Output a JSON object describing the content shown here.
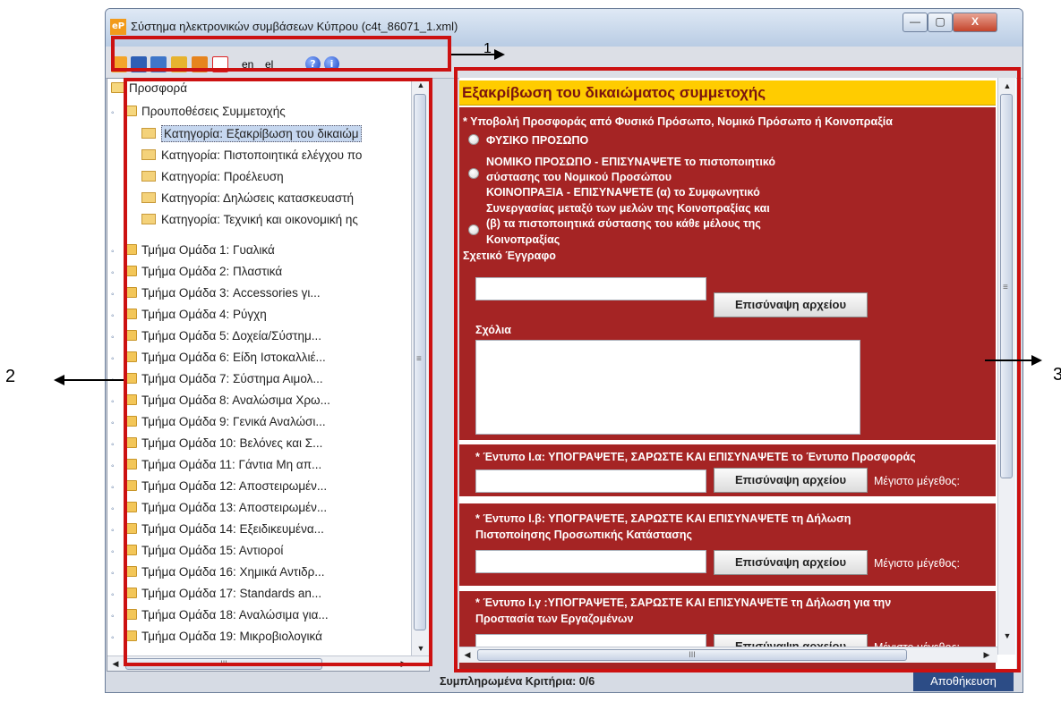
{
  "window": {
    "title": "Σύστημα ηλεκτρονικών συμβάσεων Κύπρου (c4t_86071_1.xml)",
    "app_icon": "eP",
    "min_glyph": "—",
    "max_glyph": "▢",
    "close_glyph": "X"
  },
  "toolbar": {
    "icons": [
      "new-icon",
      "save-icon",
      "save-as-icon",
      "open-icon",
      "package-icon",
      "pdf-icon"
    ],
    "lang_en": "en",
    "lang_el": "el",
    "help_glyph": "?",
    "info_glyph": "i"
  },
  "tree": {
    "root": "Προσφορά",
    "participation": "Προυποθέσεις Συμμετοχής",
    "categories": [
      "Κατηγορία: Εξακρίβωση του δικαιώμ",
      "Κατηγορία: Πιστοποιητικά ελέγχου πο",
      "Κατηγορία: Προέλευση",
      "Κατηγορία: Δηλώσεις κατασκευαστή",
      "Κατηγορία: Τεχνική και οικονομική ης"
    ],
    "groups": [
      "Τμήμα Ομάδα 1: Γυαλικά",
      "Τμήμα Ομάδα 2: Πλαστικά",
      "Τμήμα Ομάδα 3: Accessories γι...",
      "Τμήμα Ομάδα 4: Ρύγχη",
      "Τμήμα Ομάδα 5: Δοχεία/Σύστημ...",
      "Τμήμα Ομάδα 6: Είδη Ιστοκαλλιέ...",
      "Τμήμα Ομάδα 7: Σύστημα Αιμολ...",
      "Τμήμα Ομάδα 8: Αναλώσιμα Χρω...",
      "Τμήμα Ομάδα 9: Γενικά Αναλώσι...",
      "Τμήμα Ομάδα 10: Βελόνες και Σ...",
      "Τμήμα Ομάδα 11: Γάντια Μη απ...",
      "Τμήμα Ομάδα 12: Αποστειρωμέν...",
      "Τμήμα Ομάδα 13: Αποστειρωμέν...",
      "Τμήμα Ομάδα 14: Εξειδικευμένα...",
      "Τμήμα Ομάδα 15: Αντιοροί",
      "Τμήμα Ομάδα 16: Χημικά Αντιδρ...",
      "Τμήμα Ομάδα 17: Standards an...",
      "Τμήμα Ομάδα 18: Αναλώσιμα για...",
      "Τμήμα Ομάδα 19: Μικροβιολογικά"
    ],
    "hscroll_glyph": "III",
    "vscroll_glyph": "≡"
  },
  "form": {
    "header": "Εξακρίβωση του δικαιώματος συμμετοχής",
    "section1": {
      "title": "* Υποβολή Προσφοράς από Φυσικό Πρόσωπο, Νομικό Πρόσωπο ή Κοινοπραξία",
      "opt1": "ΦΥΣΙΚΟ ΠΡΟΣΩΠΟ",
      "opt2_l1": "ΝΟΜΙΚΟ ΠΡΟΣΩΠΟ - ΕΠΙΣΥΝΑΨΕΤΕ το πιστοποιητικό",
      "opt2_l2": "σύστασης του Νομικού Προσώπου",
      "opt3_l1": "ΚΟΙΝΟΠΡΑΞΙΑ - ΕΠΙΣΥΝΑΨΕΤΕ (α) το Συμφωνητικό",
      "opt3_l2": "Συνεργασίας μεταξύ των μελών της Κοινοπραξίας και",
      "opt3_l3": "(β) τα πιστοποιητικά σύστασης του κάθε μέλους της",
      "opt3_l4": "Κοινοπραξίας",
      "doc_label": "Σχετικό Έγγραφο",
      "attach": "Επισύναψη αρχείου",
      "comments_label": "Σχόλια"
    },
    "section2": {
      "title": "* Έντυπο Ι.α: ΥΠΟΓΡΑΨΕΤΕ, ΣΑΡΩΣΤΕ ΚΑΙ ΕΠΙΣΥΝΑΨΕΤΕ το Έντυπο Προσφοράς",
      "attach": "Επισύναψη αρχείου",
      "max_size": "Μέγιστο μέγεθος:"
    },
    "section3": {
      "title_l1": "* Έντυπο Ι.β: ΥΠΟΓΡΑΨΕΤΕ, ΣΑΡΩΣΤΕ ΚΑΙ ΕΠΙΣΥΝΑΨΕΤΕ τη Δήλωση",
      "title_l2": "Πιστοποίησης Προσωπικής Κατάστασης",
      "attach": "Επισύναψη αρχείου",
      "max_size": "Μέγιστο μέγεθος:"
    },
    "section4": {
      "title_l1": "* Έντυπο Ι.γ :ΥΠΟΓΡΑΨΕΤΕ, ΣΑΡΩΣΤΕ ΚΑΙ ΕΠΙΣΥΝΑΨΕΤΕ τη Δήλωση για την",
      "title_l2": "Προστασία των Εργαζομένων",
      "attach": "Επισύναψη αρχείου",
      "max_size": "Μέγιστο μέγεθος:"
    }
  },
  "status": {
    "filled": "Συμπληρωμένα Κριτήρια: 0/6",
    "save": "Αποθήκευση"
  },
  "annotations": {
    "label_1": "1",
    "label_2": "2",
    "label_3": "3"
  },
  "colors": {
    "highlight": "#cc1111",
    "section_bg": "#a52424",
    "header_bg": "#ffcc00",
    "save_bg": "#2c4c86"
  }
}
